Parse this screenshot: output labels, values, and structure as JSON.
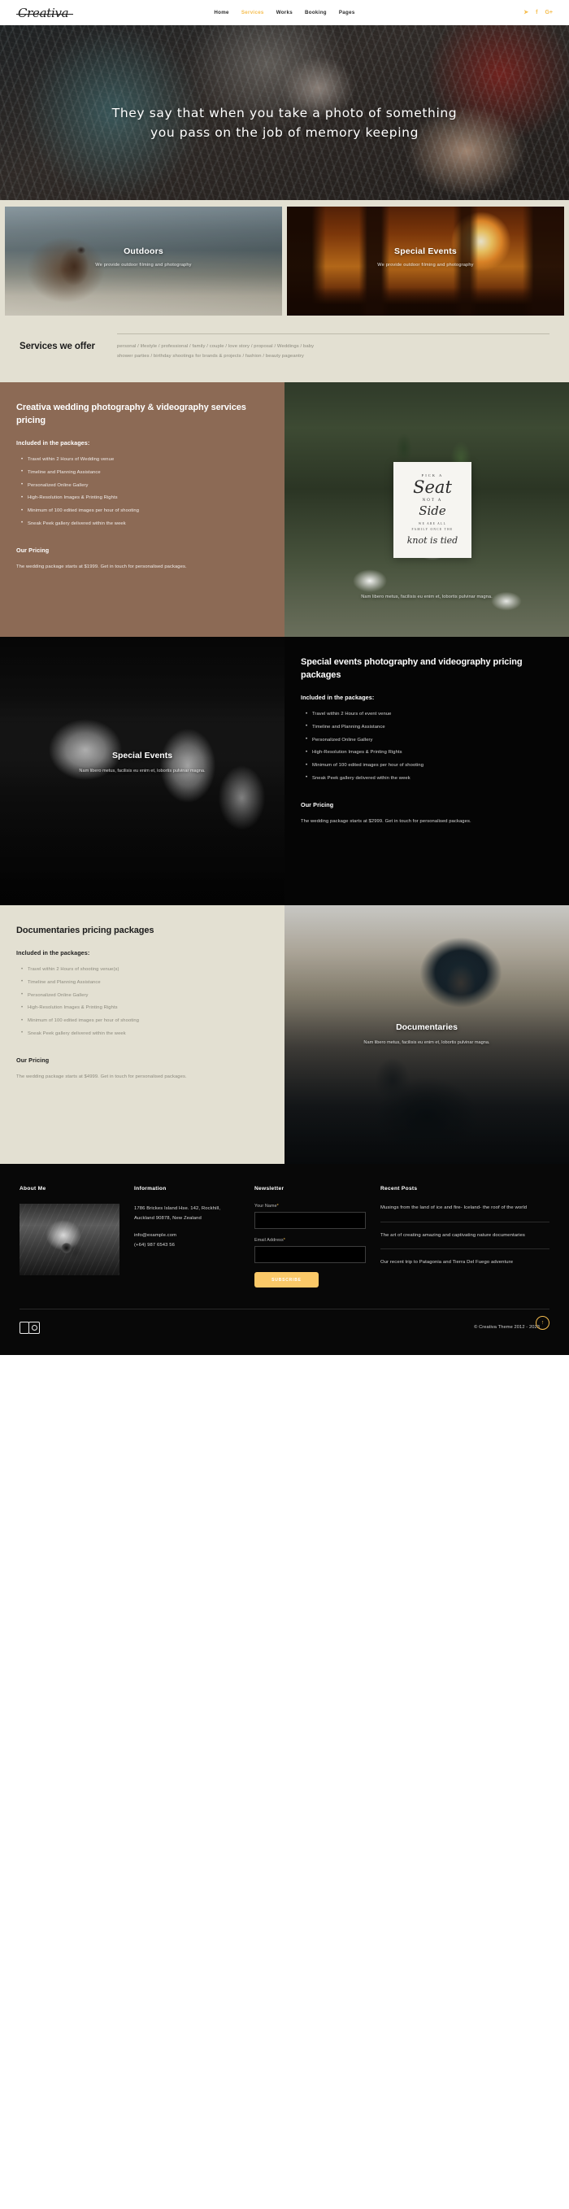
{
  "header": {
    "logo": "Creativa",
    "nav": [
      {
        "label": "Home",
        "active": false
      },
      {
        "label": "Services",
        "active": true
      },
      {
        "label": "Works",
        "active": false
      },
      {
        "label": "Booking",
        "active": false
      },
      {
        "label": "Pages",
        "active": false
      }
    ],
    "social": [
      {
        "name": "twitter-icon",
        "glyph": "🐦"
      },
      {
        "name": "facebook-icon",
        "glyph": "f"
      },
      {
        "name": "google-plus-icon",
        "glyph": "G+"
      }
    ]
  },
  "hero": {
    "quote": "They say that when you take a photo of something you pass on the job of memory keeping"
  },
  "service_cards": [
    {
      "title": "Outdoors",
      "subtitle": "We provide outdoor filming and photography"
    },
    {
      "title": "Special Events",
      "subtitle": "We provide outdoor filming and photography"
    }
  ],
  "services_offer": {
    "title": "Services we offer",
    "line1": "personal / lifestyle / professional / family / couple / love story / proposal / Weddings / baby",
    "line2": "shower parties / birthday shootings for brands & projects / fashion / beauty pageantry"
  },
  "sections": [
    {
      "id": "wedding",
      "heading": "Creativa wedding photography & videography services pricing",
      "included_label": "Included in the packages:",
      "items": [
        "Travel within 2 Hours of Wedding venue",
        "Timeline and Planning Assistance",
        "Personalized Online Gallery",
        "High-Resolution Images & Printing Rights",
        "Minimum of 100 edited images per hour of shooting",
        "Sneak Peek gallery delivered within the week"
      ],
      "pricing_label": "Our Pricing",
      "pricing_text": "The wedding package starts at $1999. Get in touch for personalised packages.",
      "image_caption": "Nam libero metus, facilisis eu enim et, lobortis pulvinar magna.",
      "sign": {
        "l1": "PICK A",
        "l2": "Seat",
        "l3": "NOT A",
        "l4": "Side",
        "l5": "WE ARE ALL",
        "l6": "FAMILY ONCE THE",
        "l7": "knot is tied"
      }
    },
    {
      "id": "events",
      "heading": "Special events photography and videography pricing packages",
      "included_label": "Included in the packages:",
      "items": [
        "Travel within 2 Hours of event venue",
        "Timeline and Planning Assistance",
        "Personalized Online Gallery",
        "High-Resolution Images & Printing Rights",
        "Minimum of 100 edited images per hour of shooting",
        "Sneak Peek gallery delivered within the week"
      ],
      "pricing_label": "Our Pricing",
      "pricing_text": "The wedding package starts at $2999. Get in touch for personalised packages.",
      "image_label": "Special Events",
      "image_caption": "Nam libero metus, facilisis eu enim et, lobortis pulvinar magna."
    },
    {
      "id": "documentaries",
      "heading": "Documentaries pricing packages",
      "included_label": "Included in the packages:",
      "items": [
        "Travel within 2 Hours of shooting venue(s)",
        "Timeline and Planning Assistance",
        "Personalized Online Gallery",
        "High-Resolution Images & Printing Rights",
        "Minimum of 100 edited images per hour of shooting",
        "Sneak Peek gallery delivered within the week"
      ],
      "pricing_label": "Our Pricing",
      "pricing_text": "The wedding package starts at $4999. Get in touch for personalised packages.",
      "image_label": "Documentaries",
      "image_caption": "Nam libero metus, facilisis eu enim et, lobortis pulvinar magna."
    }
  ],
  "footer": {
    "about": {
      "title": "About Me"
    },
    "information": {
      "title": "Information",
      "address_line1": "1786 Brickes Island Hse. 142, Rockhill,",
      "address_line2": "Auckland 90878, New Zealand",
      "email": "info@example.com",
      "phone": "(+64) 987 6543 56"
    },
    "newsletter": {
      "title": "Newsletter",
      "name_label": "Your Name",
      "name_value": "",
      "name_placeholder": "",
      "email_label": "Email Address",
      "email_value": "",
      "email_placeholder": "",
      "required_mark": "*",
      "subscribe_label": "SUBSCRIBE"
    },
    "recent_posts": {
      "title": "Recent Posts",
      "posts": [
        "Musings from the land of ice and fire- Iceland- the roof of the world",
        "The art of creating amazing and captivating nature documentaries",
        "Our recent trip to Patagonia and Tierra Del Fuego adventure"
      ]
    },
    "copyright": "© Creativa Theme 2012 - 2023",
    "to_top_icon": "↑"
  },
  "colors": {
    "accent": "#f5bd4f",
    "cream": "#e3e0d2",
    "brown": "#8c6a55",
    "black": "#050505"
  }
}
